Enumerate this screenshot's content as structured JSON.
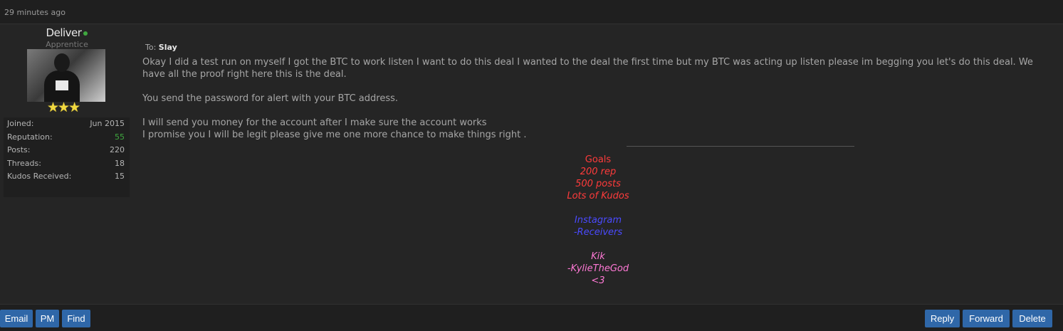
{
  "post": {
    "timestamp": "29 minutes ago",
    "to_label": "To:",
    "to_user": "Slay",
    "paragraphs": [
      "Okay I did a test run on myself I got the BTC to work listen I want to do this deal I wanted to the deal the first time but my BTC was acting up listen please im begging you let's do this deal. We have all the proof right here this is the deal.",
      "You send the password for alert with your BTC address.",
      "I will send you money for the account after I make sure  the account works",
      "I promise you I will be legit please give me one more chance to make things right ."
    ]
  },
  "user": {
    "username": "Deliver",
    "online": true,
    "title": "Apprentice",
    "stars": "★★★",
    "stats": [
      {
        "label": "Joined:",
        "value": "Jun 2015"
      },
      {
        "label": "Reputation:",
        "value": "55"
      },
      {
        "label": "Posts:",
        "value": "220"
      },
      {
        "label": "Threads:",
        "value": "18"
      },
      {
        "label": "Kudos Received:",
        "value": "15"
      }
    ]
  },
  "signature": {
    "goals_title": "Goals",
    "goals": [
      "200 rep",
      "500 posts",
      "Lots of Kudos"
    ],
    "instagram": [
      "Instagram",
      "-Receivers"
    ],
    "kik": [
      "Kik",
      "-KylieTheGod",
      "<3"
    ]
  },
  "buttons": {
    "email": "Email",
    "pm": "PM",
    "find": "Find",
    "reply": "Reply",
    "forward": "Forward",
    "delete": "Delete"
  },
  "colors": {
    "button_bg": "#2f67a8",
    "online": "#3fa83f",
    "goals": "#ff3b3b",
    "instagram": "#4a4aff",
    "kik": "#ff79d6"
  }
}
